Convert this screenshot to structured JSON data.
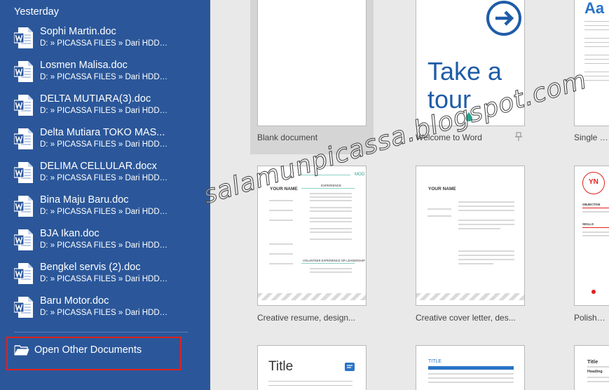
{
  "sidebar": {
    "section_label": "Yesterday",
    "items": [
      {
        "name": "Sophi Martin.doc",
        "path": "D: » PICASSA FILES » Dari HDD »..."
      },
      {
        "name": "Losmen Malisa.doc",
        "path": "D: » PICASSA FILES » Dari HDD »..."
      },
      {
        "name": "DELTA MUTIARA(3).doc",
        "path": "D: » PICASSA FILES » Dari HDD »..."
      },
      {
        "name": "Delta Mutiara TOKO MAS...",
        "path": "D: » PICASSA FILES » Dari HDD »..."
      },
      {
        "name": "DELIMA CELLULAR.docx",
        "path": "D: » PICASSA FILES » Dari HDD »..."
      },
      {
        "name": "Bina Maju Baru.doc",
        "path": "D: » PICASSA FILES » Dari HDD »..."
      },
      {
        "name": "BJA Ikan.doc",
        "path": "D: » PICASSA FILES » Dari HDD »..."
      },
      {
        "name": "Bengkel servis (2).doc",
        "path": "D: » PICASSA FILES » Dari HDD »..."
      },
      {
        "name": "Baru Motor.doc",
        "path": "D: » PICASSA FILES » Dari HDD »..."
      }
    ],
    "open_other_label": "Open Other Documents"
  },
  "templates": {
    "blank": "Blank document",
    "welcome": "Welcome to Word",
    "single_spaced": "Single spa",
    "creative_resume": "Creative resume, design...",
    "creative_cover": "Creative cover letter, des...",
    "polished": "Polished r"
  },
  "thumbs": {
    "tour_line1": "Take a",
    "tour_line2": "tour",
    "aa": "Aa",
    "your_name": "YOUR NAME",
    "moo": "MOO",
    "experience": "EXPERIENCE",
    "volunteer": "VOLUNTEER EXPERIENCE OR LEADERSHIP",
    "yn": "YN",
    "objective": "OBJECTIVE",
    "skills": "SKILLS",
    "title_big": "Title",
    "title_small": "TITLE",
    "title_right": "Title",
    "heading": "Heading"
  },
  "watermark": "salamunpicassa.blogspot.com",
  "colors": {
    "sidebar": "#2b579a",
    "highlight": "#e0211c",
    "accent": "#1f5ca8",
    "teal": "#2aa38f"
  }
}
